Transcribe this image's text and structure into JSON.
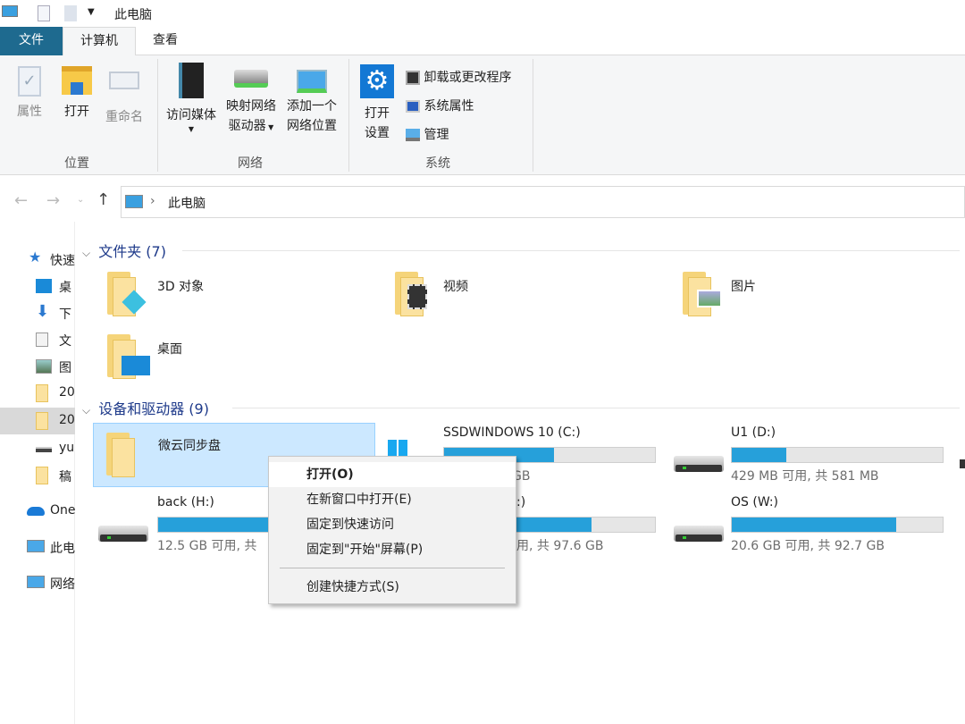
{
  "window": {
    "title": "此电脑"
  },
  "ribbon": {
    "tabs": [
      {
        "label": "文件"
      },
      {
        "label": "计算机"
      },
      {
        "label": "查看"
      }
    ],
    "groups": {
      "location": {
        "label": "位置",
        "buttons": [
          {
            "label": "属性",
            "icon": "properties-icon"
          },
          {
            "label": "打开",
            "icon": "open-folder-icon"
          },
          {
            "label": "重命名",
            "icon": "rename-icon"
          }
        ]
      },
      "network": {
        "label": "网络",
        "buttons": [
          {
            "label": "访问媒体",
            "icon": "media-icon"
          },
          {
            "label1": "映射网络",
            "label2": "驱动器",
            "icon": "map-drive-icon"
          },
          {
            "label1": "添加一个",
            "label2": "网络位置",
            "icon": "network-location-icon"
          }
        ]
      },
      "system": {
        "label": "系统",
        "open_settings1": "打开",
        "open_settings2": "设置",
        "items": [
          {
            "label": "卸载或更改程序",
            "icon": "uninstall-icon"
          },
          {
            "label": "系统属性",
            "icon": "system-properties-icon"
          },
          {
            "label": "管理",
            "icon": "manage-icon"
          }
        ]
      }
    }
  },
  "address": {
    "path": "此电脑"
  },
  "nav": {
    "items": [
      {
        "label": "快速",
        "icon": "star-icon"
      },
      {
        "label": "桌",
        "icon": "desktop-icon"
      },
      {
        "label": "下",
        "icon": "download-icon"
      },
      {
        "label": "文",
        "icon": "document-icon"
      },
      {
        "label": "图",
        "icon": "picture-icon"
      },
      {
        "label": "20",
        "icon": "folder-icon"
      },
      {
        "label": "20",
        "icon": "folder-icon",
        "selected": true
      },
      {
        "label": "yu",
        "icon": "drive-icon"
      },
      {
        "label": "稿",
        "icon": "folder-icon"
      },
      {
        "label": "One",
        "icon": "onedrive-icon"
      },
      {
        "label": "此电",
        "icon": "computer-icon"
      },
      {
        "label": "网络",
        "icon": "network-icon"
      }
    ]
  },
  "folders": {
    "header": "文件夹 (7)",
    "items": [
      {
        "name": "3D 对象"
      },
      {
        "name": "视频"
      },
      {
        "name": "图片"
      },
      {
        "name": "桌面"
      }
    ]
  },
  "devices": {
    "header": "设备和驱动器 (9)",
    "items": [
      {
        "name": "微云同步盘",
        "selected": true
      },
      {
        "name": "SSDWINDOWS 10 (C:)",
        "free": "用, 共 47.6 GB",
        "used_pct": 52
      },
      {
        "name": "U1 (D:)",
        "free": "429 MB 可用, 共 581 MB",
        "used_pct": 26
      },
      {
        "name": "back (H:)",
        "free": "12.5 GB 可用, 共",
        "used_pct": 100
      },
      {
        "name": ":)",
        "free": "用, 共 97.6 GB",
        "used_pct": 70
      },
      {
        "name": "OS (W:)",
        "free": "20.6 GB 可用, 共 92.7 GB",
        "used_pct": 78
      }
    ]
  },
  "context_menu": {
    "items": [
      {
        "label": "打开(O)"
      },
      {
        "label": "在新窗口中打开(E)"
      },
      {
        "label": "固定到快速访问"
      },
      {
        "label": "固定到\"开始\"屏幕(P)"
      },
      {
        "label": "创建快捷方式(S)"
      }
    ]
  },
  "colors": {
    "accent": "#1e6a8f",
    "bar": "#26a0da",
    "selection": "#cce8ff"
  }
}
